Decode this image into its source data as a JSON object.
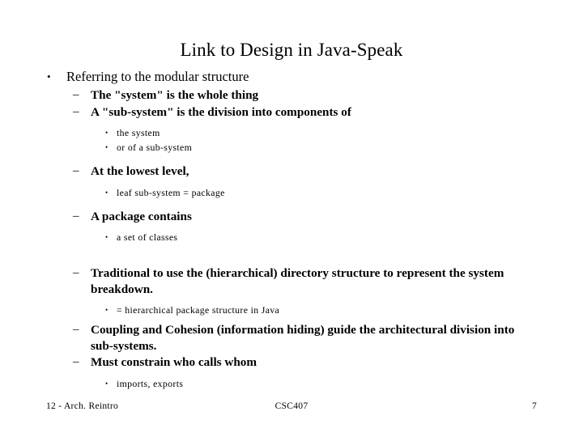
{
  "slide": {
    "title": "Link to Design in Java-Speak",
    "background_color": "#ffffff",
    "text_color": "#000000",
    "markers": {
      "level1": "•",
      "level2": "–",
      "level3": "•"
    },
    "content": {
      "b1": "Referring to the modular structure",
      "b1_1": "The \"system\" is the whole thing",
      "b1_2": "A \"sub-system\" is the division into components of",
      "b1_2_1": "the system",
      "b1_2_2": "or of a sub-system",
      "b2": "At the lowest level,",
      "b2_1": "leaf sub-system = package",
      "b3": "A package contains",
      "b3_1": "a set of classes",
      "b4": "Traditional to use the (hierarchical) directory structure to represent the system breakdown.",
      "b4_1": "= hierarchical package structure in Java",
      "b5": "Coupling and Cohesion (information hiding) guide the architectural division into sub-systems.",
      "b6": "Must constrain who calls whom",
      "b6_1": "imports, exports"
    }
  },
  "footer": {
    "left": "12 - Arch. Reintro",
    "center": "CSC407",
    "page_number": "7"
  }
}
